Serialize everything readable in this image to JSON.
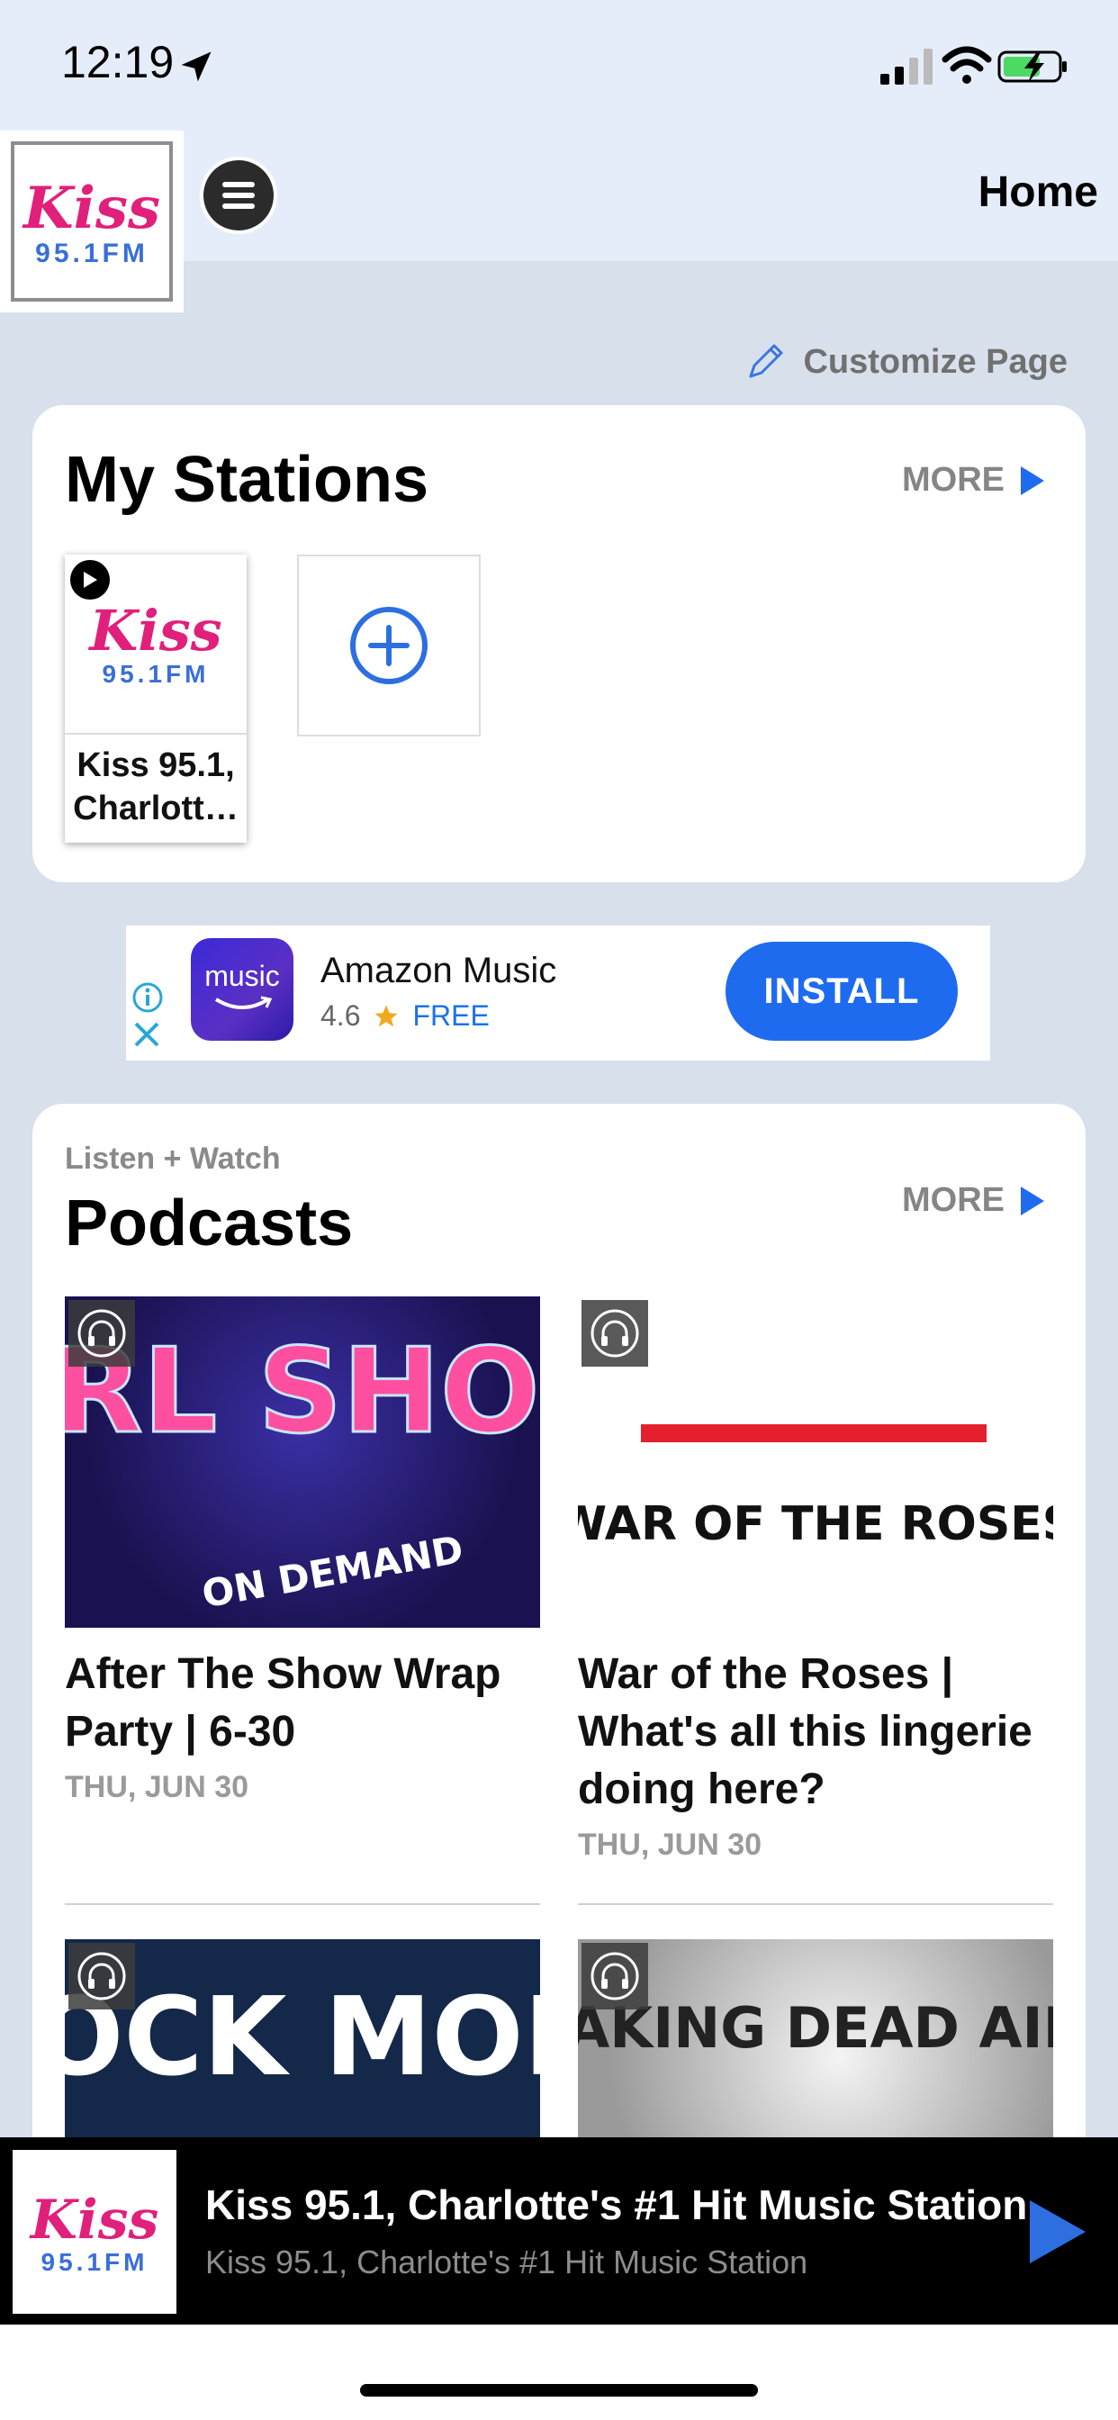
{
  "status": {
    "time": "12:19",
    "icons": [
      "location-arrow-icon",
      "signal-icon",
      "wifi-icon",
      "battery-charging-icon"
    ]
  },
  "header": {
    "logo_text": "Kiss",
    "logo_sub": "95.1FM",
    "title": "Home",
    "menu_icon": "hamburger-icon"
  },
  "customize": {
    "label": "Customize Page",
    "icon": "pencil-icon"
  },
  "stations": {
    "title": "My Stations",
    "more_label": "MORE",
    "items": [
      {
        "name": "Kiss 95.1, Charlott…"
      }
    ],
    "add_icon": "plus-circle-icon"
  },
  "ad": {
    "app_name": "Amazon Music",
    "icon_text": "music",
    "rating": "4.6",
    "price": "FREE",
    "install_label": "INSTALL"
  },
  "podcasts": {
    "subtitle": "Listen + Watch",
    "title": "Podcasts",
    "more_label": "MORE",
    "items": [
      {
        "art_text": "MRL SHOW",
        "art_sub": "ON DEMAND",
        "title": "After The Show Wrap Party | 6-30",
        "date": "THU, JUN 30"
      },
      {
        "art_text": "WAR OF THE ROSES",
        "title": "War of the Roses | What's all this lingerie doing here?",
        "date": "THU, JUN 30"
      },
      {
        "art_text": "MOCK MORE"
      },
      {
        "art_text": "TAKING DEAD AIM"
      }
    ]
  },
  "player": {
    "title": "Kiss 95.1, Charlotte's #1 Hit Music Station",
    "subtitle": "Kiss 95.1, Charlotte's #1 Hit Music Station"
  },
  "colors": {
    "accent": "#1f6bf0",
    "kiss_pink": "#e0207a",
    "kiss_blue": "#3a6fd8"
  }
}
